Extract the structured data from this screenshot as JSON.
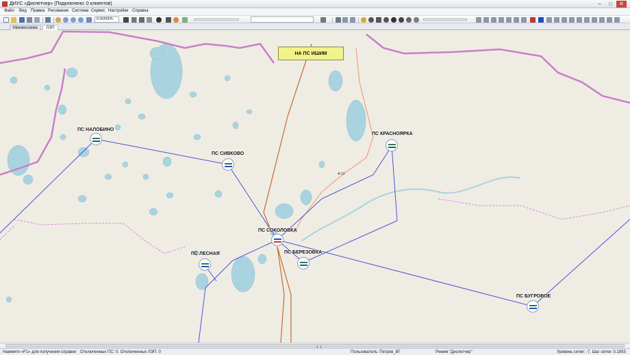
{
  "window": {
    "title": "ДИУС «Диспетчер» (Подключено: 0 клиентов)",
    "minimize": "–",
    "maximize": "□",
    "close": "✕"
  },
  "menu": [
    "Файл",
    "Вид",
    "Правка",
    "Рисование",
    "Система",
    "Сервис",
    "Настройки",
    "Справка"
  ],
  "toolbar": {
    "zoom_value": "0.0003%"
  },
  "tabs": [
    {
      "label": "Мнемосхема",
      "active": false
    },
    {
      "label": "ЛЭП",
      "active": true
    }
  ],
  "map": {
    "external_label": "НА ПС ИШИМ",
    "road_label": "А-12",
    "substations": [
      {
        "name": "ПС НАЛОБИНО",
        "flag": [
          "#2e7d32",
          "#ffffff",
          "#1e4fbf"
        ]
      },
      {
        "name": "ПС СИВКОВО",
        "flag": [
          "#2e7d32",
          "#ffffff",
          "#1e4fbf"
        ]
      },
      {
        "name": "ПС КРАСНОЯРКА",
        "flag": [
          "#2e7d32",
          "#ffffff",
          "#1e4fbf"
        ]
      },
      {
        "name": "ПС СОКОЛОВКА",
        "flag": [
          "#1e4fbf",
          "#ffffff",
          "#d32f2f"
        ]
      },
      {
        "name": "ПС ЛЕСНАЯ",
        "flag": [
          "#2e7d32",
          "#ffffff",
          "#1e4fbf"
        ]
      },
      {
        "name": "ПС БЕРЕЗОВКА",
        "flag": [
          "#2e7d32",
          "#ffffff",
          "#1e4fbf"
        ]
      },
      {
        "name": "ПС БУГРОВОЕ",
        "flag": [
          "#2e7d32",
          "#ffffff",
          "#1e4fbf"
        ]
      }
    ],
    "colors": {
      "land": "#efece4",
      "water": "#a9d3df",
      "region_border": "#c77ec9",
      "transmission_line": "#4f4fd6",
      "external_line": "#c46a2e",
      "road": "#f2a27a"
    }
  },
  "status": {
    "help": "Нажмите «F1» для получения справки",
    "disconnected": "Отключенных ПС: 0. Отключенных ЛЭП: 0",
    "user": "Пользователь: Петров_ВГ",
    "mode": "Режим \"Диспетчер\"",
    "grid": "Уровень сетки: -7, Шаг сетки: 0.1953"
  }
}
